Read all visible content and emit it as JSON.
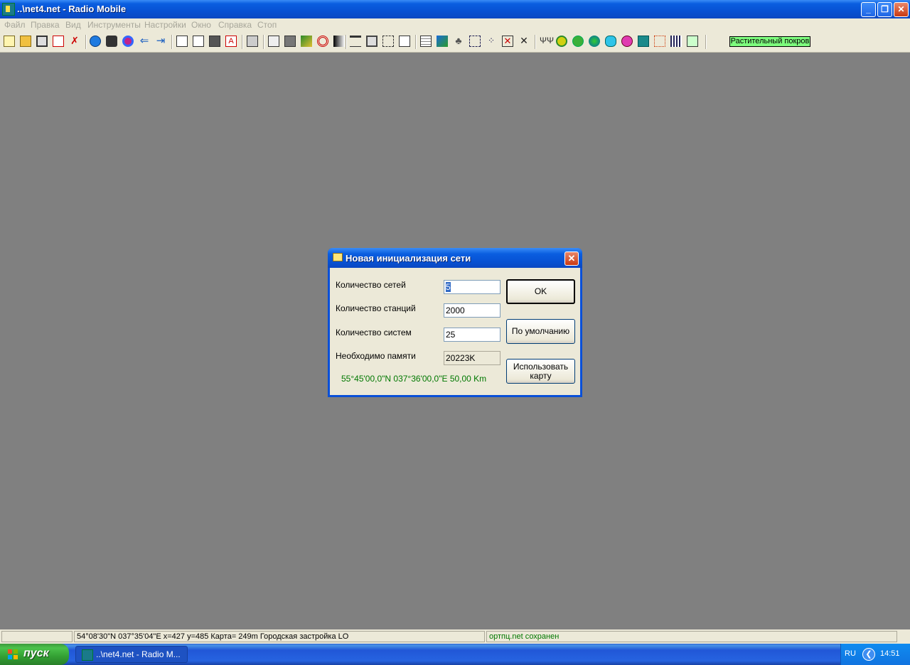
{
  "window": {
    "title": "..\\net4.net - Radio Mobile",
    "min_glyph": "_",
    "restore_glyph": "❐",
    "close_glyph": "✕"
  },
  "menu": [
    "Файл",
    "Правка",
    "Вид",
    "Инструменты",
    "Настройки",
    "Окно",
    "Справка",
    "Стоп"
  ],
  "toolbar": {
    "vegetation_label": "Растительный покров",
    "icons": [
      "new-icon",
      "open-icon",
      "copy-pages-icon",
      "network-properties-icon",
      "units-icon",
      "globe-icon",
      "save-icon",
      "target-icon",
      "back-icon",
      "forward-icon",
      "doc-icon",
      "doc-edit-icon",
      "save-doc-icon",
      "pdf-icon",
      "print-icon",
      "copy-icon",
      "paste-icon",
      "terrain-icon",
      "radar-icon",
      "gradient-icon",
      "ruler-icon",
      "frame-icon",
      "grid-icon",
      "compass-icon",
      "table-icon",
      "map-icon",
      "person-icon",
      "select-icon",
      "points-icon",
      "cross-box-icon",
      "cross-icon",
      "antenna-icon",
      "coverage-icon",
      "earth-green-icon",
      "earth-blue-icon",
      "cylinder-icon",
      "globe-pink-icon",
      "spectrum-icon",
      "network-icon",
      "bars-icon",
      "route-icon"
    ]
  },
  "dialog": {
    "title": "Новая инициализация сети",
    "close_glyph": "✕",
    "fields": [
      {
        "label": "Количество сетей",
        "value": "5"
      },
      {
        "label": "Количество станций",
        "value": "2000"
      },
      {
        "label": "Количество систем",
        "value": "25"
      },
      {
        "label": "Необходимо памяти",
        "value": "20223K"
      }
    ],
    "buttons": {
      "ok": "OK",
      "default": "По умолчанию",
      "use_map_line1": "Использовать",
      "use_map_line2": "карту"
    },
    "coords": "55°45'00,0\"N 037°36'00,0\"E 50,00 Km"
  },
  "statusbar": {
    "pane1": "",
    "pane2": "54°08'30\"N  037°35'04\"E   x=427 y=485 Карта= 249m Городская застройка LO",
    "pane3": "ортпц.net сохранен"
  },
  "taskbar": {
    "start_label": "пуск",
    "task_label": "..\\net4.net - Radio M...",
    "language": "RU",
    "tray_glyph": "❮",
    "clock": "14:51"
  },
  "colors": {
    "workspace": "#808080",
    "vegetation_bg": "#7dfc7d",
    "coords_text": "#007800"
  }
}
